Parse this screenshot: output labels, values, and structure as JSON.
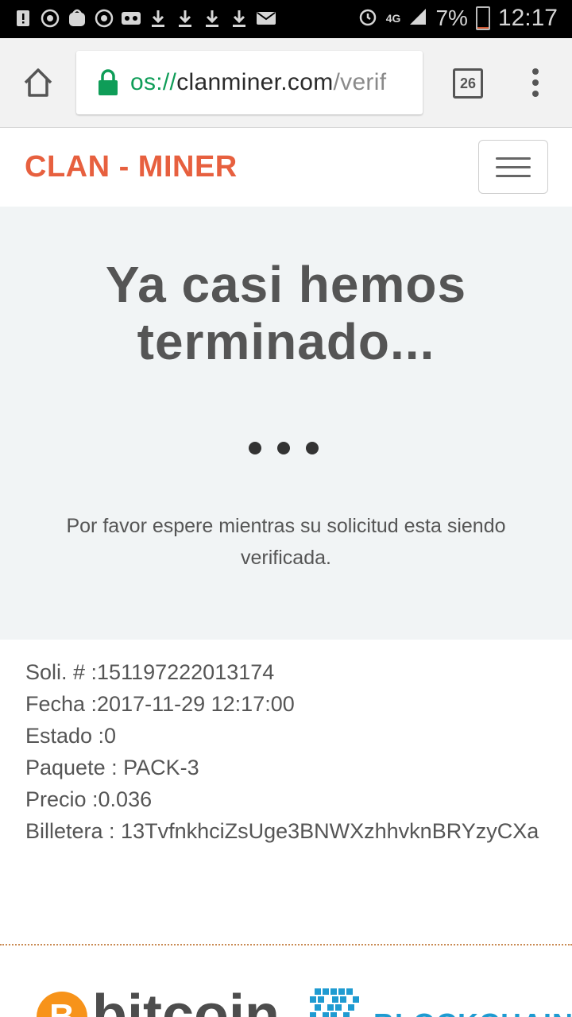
{
  "status_bar": {
    "icons": [
      "alert-icon",
      "whatsapp-icon",
      "galaxy-store-icon",
      "whatsapp-icon",
      "voicemail-icon",
      "download-icon",
      "download-icon",
      "download-icon",
      "download-icon",
      "mail-icon"
    ],
    "right_icons": [
      "alarm-icon",
      "4g-icon",
      "signal-icon"
    ],
    "network": "4G",
    "battery": "7%",
    "battery_level": 0.07,
    "time": "12:17"
  },
  "browser": {
    "url_scheme": "os://",
    "url_domain": "clanminer.com",
    "url_path": "/verif",
    "tab_count": "26"
  },
  "navbar": {
    "brand": "CLAN - MINER"
  },
  "hero": {
    "title": "Ya casi hemos terminado...",
    "message": "Por favor espere mientras su solicitud esta siendo verificada."
  },
  "details": [
    "Soli. # :151197222013174",
    "Fecha :2017-11-29 12:17:00",
    "Estado :0",
    "Paquete : PACK-3",
    "Precio :0.036",
    "Billetera : 13TvfnkhciZsUge3BNWXzhhvknBRYzyCXa"
  ],
  "footer": {
    "bitcoin_symbol": "B",
    "bitcoin_word": "bitcoin",
    "blockchain_word": "BLOCKCHAIN"
  },
  "colors": {
    "brand": "#e7603f",
    "hero_bg": "#f1f4f5",
    "secure_green": "#0f9d58",
    "bitcoin_orange": "#f7931a",
    "blockchain_blue": "#1f9bd1"
  }
}
